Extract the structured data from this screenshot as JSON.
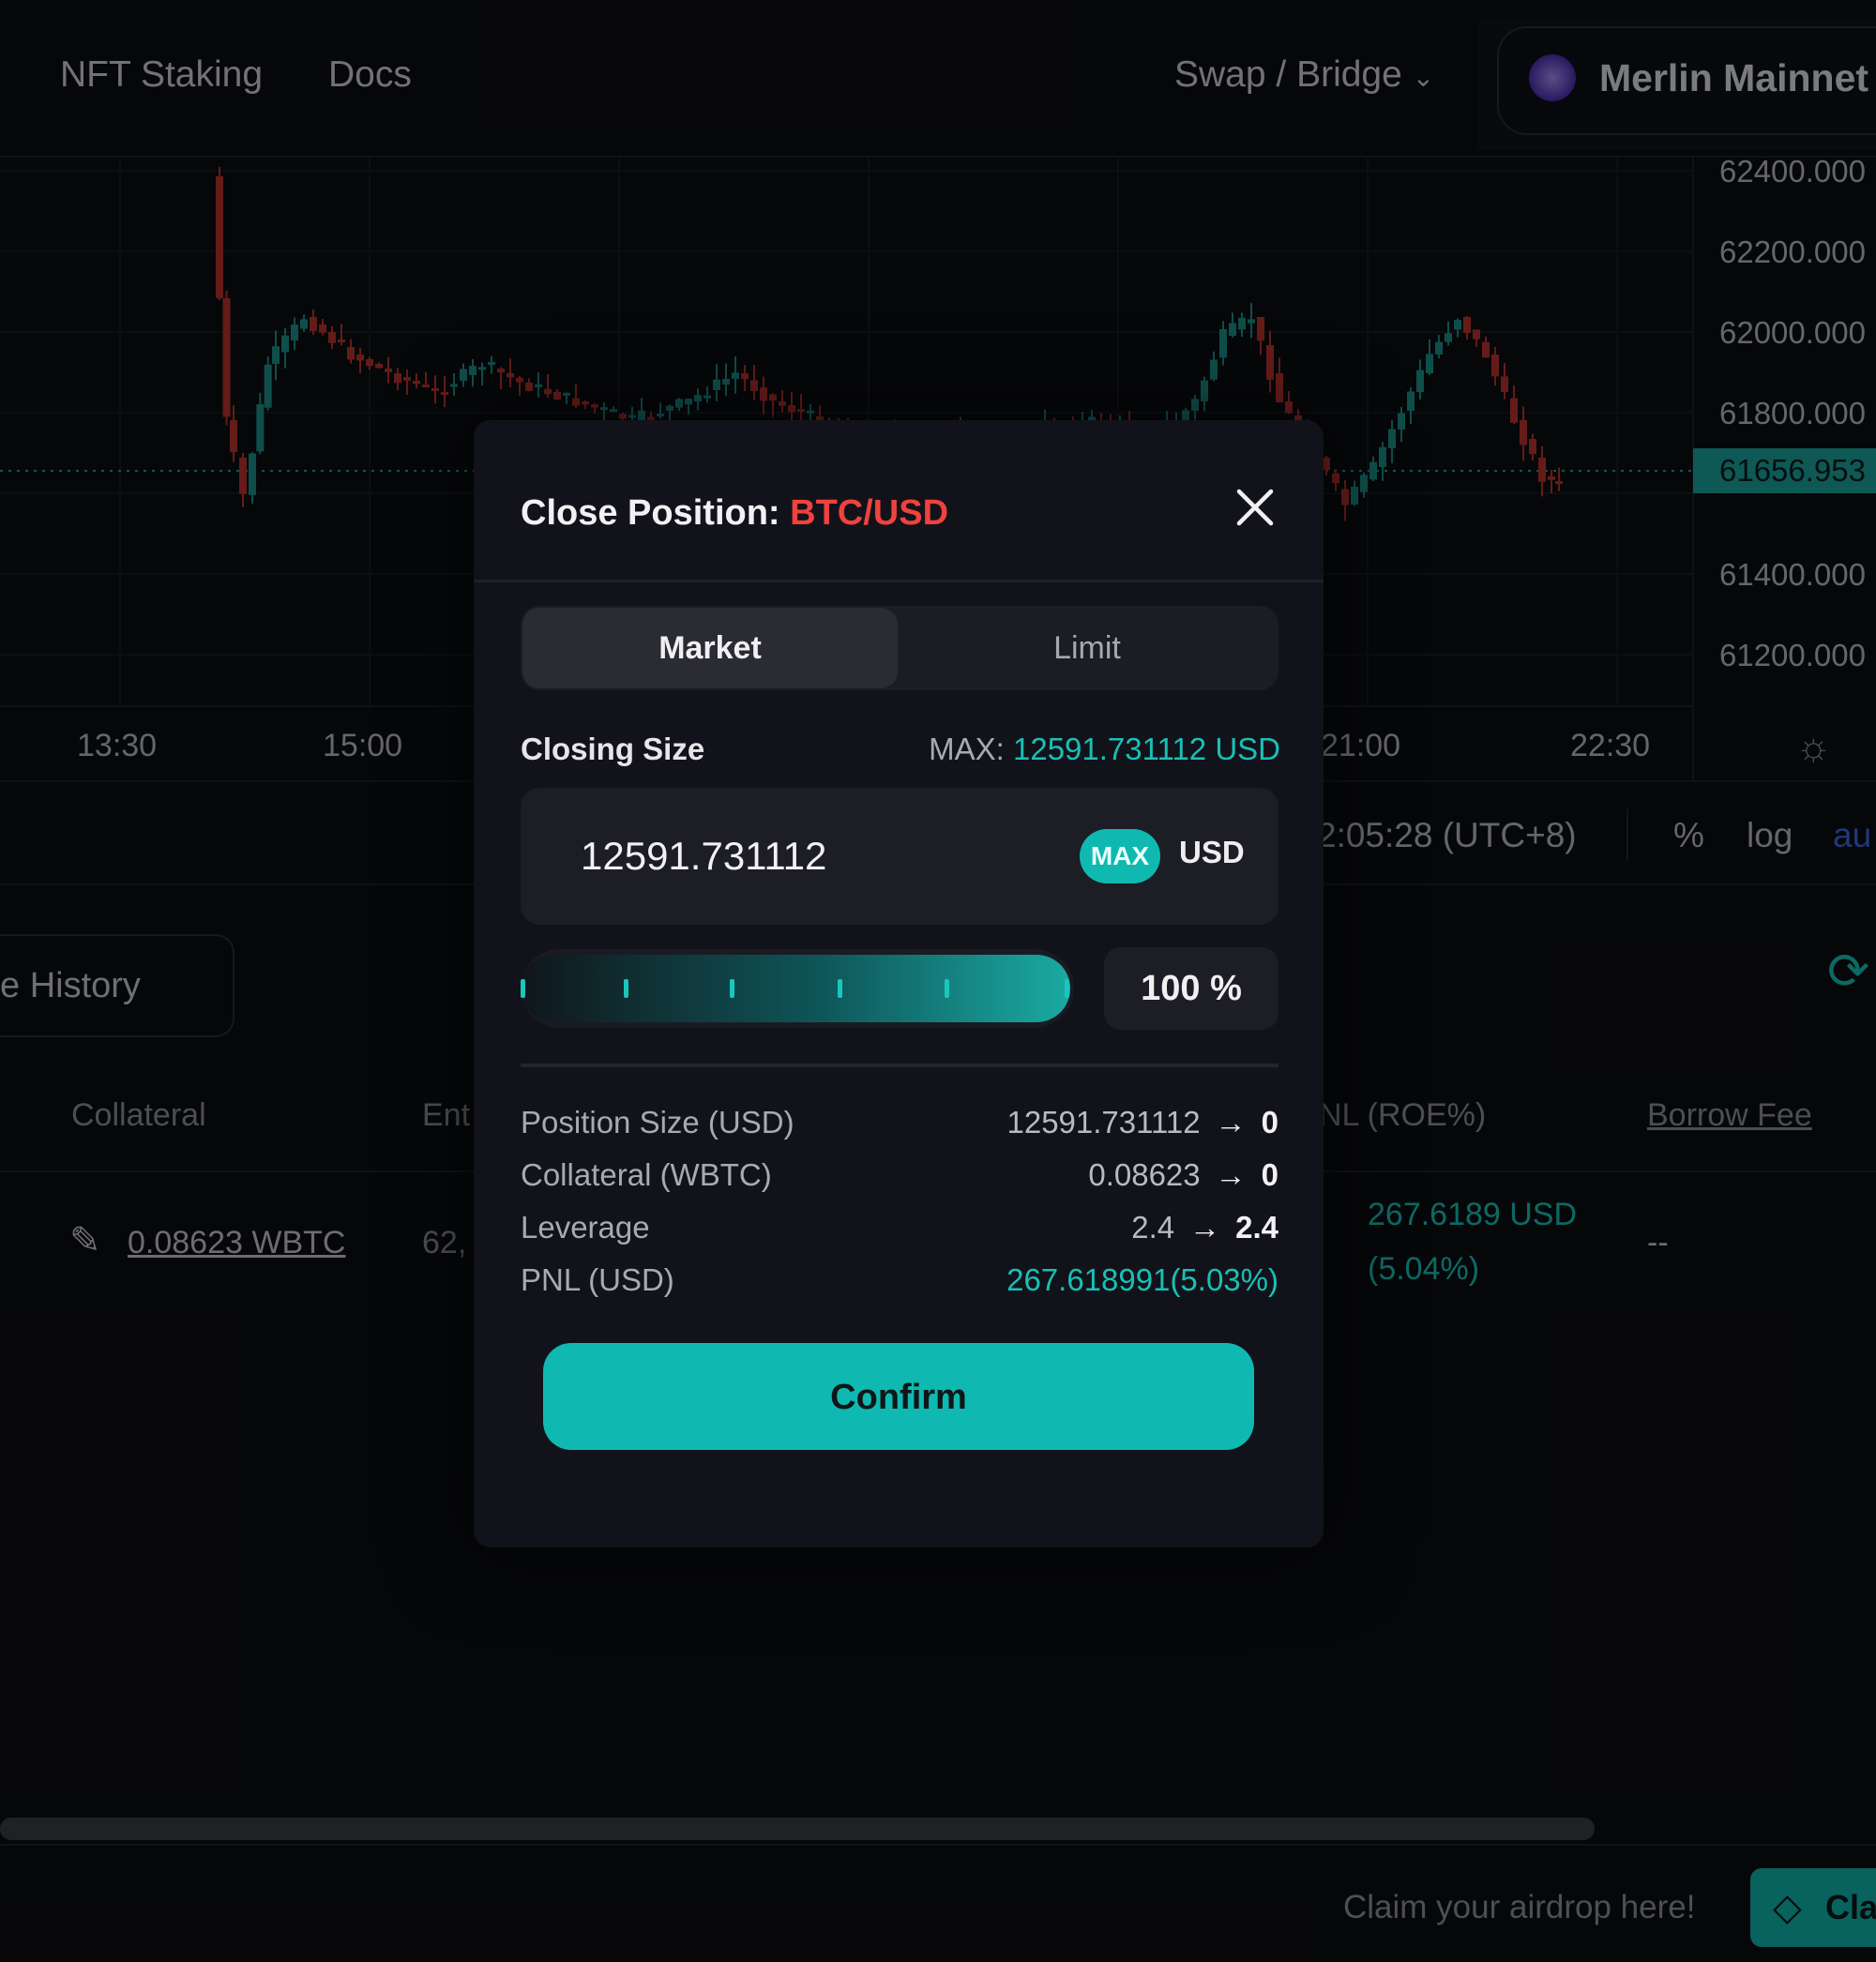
{
  "topnav": {
    "links": [
      "NFT Staking",
      "Docs"
    ],
    "swap_label": "Swap / Bridge",
    "network": "Merlin Mainnet"
  },
  "chart": {
    "y_ticks": [
      "62400.000",
      "62200.000",
      "62000.000",
      "61800.000",
      "61400.000",
      "61200.000"
    ],
    "current_price": "61656.953",
    "x_ticks": [
      "13:30",
      "15:00",
      "21:00",
      "22:30"
    ],
    "time_info": "2:05:28 (UTC+8)",
    "toggles": [
      "%",
      "log",
      "au"
    ],
    "colors": {
      "up": "#1d8f87",
      "down": "#b8332f",
      "tag": "#1aa39b"
    }
  },
  "positions": {
    "history_tab": "e History",
    "headers": [
      "Collateral",
      "Ent",
      "NL (ROE%)",
      "Borrow Fee"
    ],
    "row": {
      "collateral": "0.08623 WBTC",
      "entry": "62,",
      "pnl_line1": "267.6189 USD",
      "pnl_line2": "(5.04%)",
      "borrow_fee": "--"
    }
  },
  "footer": {
    "claim_text": "Claim your airdrop here!",
    "claim_button": "Cla"
  },
  "modal": {
    "title_prefix": "Close Position:",
    "pair": "BTC/USD",
    "tabs": {
      "market": "Market",
      "limit": "Limit"
    },
    "closing_size_label": "Closing Size",
    "max_prefix": "MAX:",
    "max_value": "12591.731112 USD",
    "input_value": "12591.731112",
    "max_chip": "MAX",
    "unit": "USD",
    "slider_percent": 100,
    "percent_label": "100 %",
    "rows": [
      {
        "label": "Position Size (USD)",
        "from": "12591.731112",
        "to": "0"
      },
      {
        "label": "Collateral (WBTC)",
        "from": "0.08623",
        "to": "0"
      },
      {
        "label": "Leverage",
        "from": "2.4",
        "to": "2.4"
      }
    ],
    "pnl_label": "PNL (USD)",
    "pnl_value": "267.618991(5.03%)",
    "confirm": "Confirm",
    "accent": "#0fb9b1",
    "pair_color": "#f0423d"
  }
}
